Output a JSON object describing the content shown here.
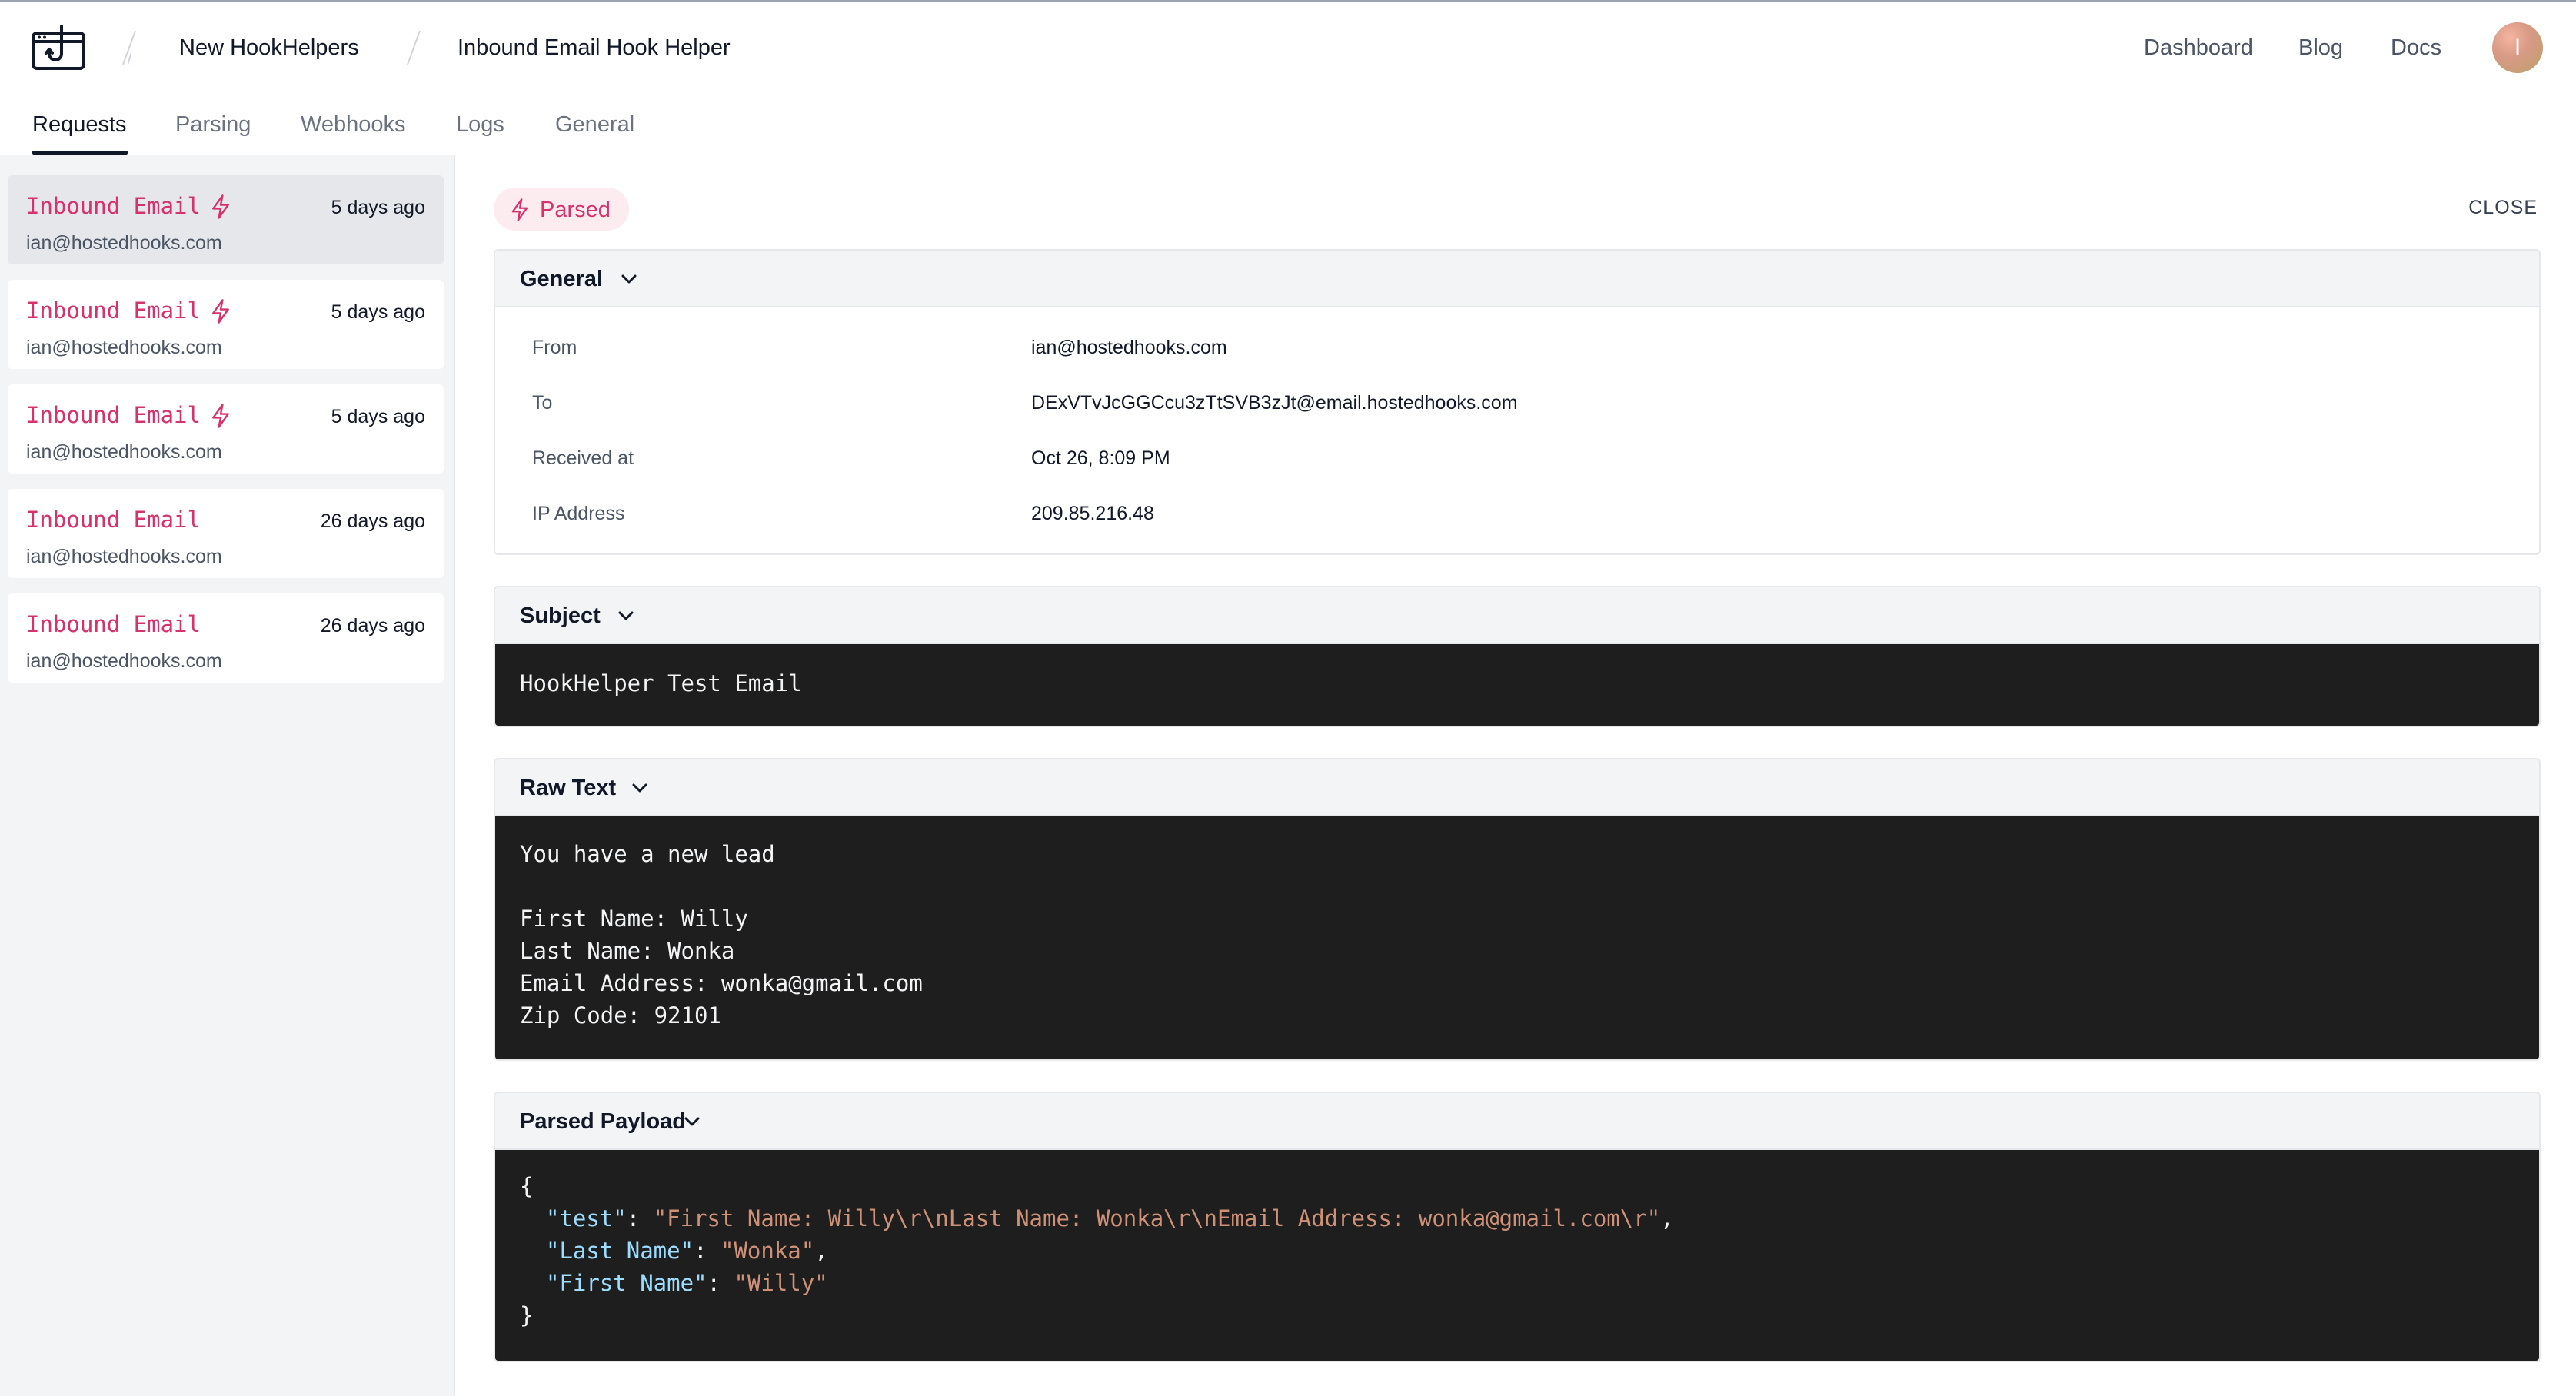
{
  "breadcrumb": {
    "project": "New HookHelpers",
    "helper": "Inbound Email Hook Helper"
  },
  "nav": {
    "dashboard": "Dashboard",
    "blog": "Blog",
    "docs": "Docs",
    "avatar_initial": "I"
  },
  "tabs": [
    "Requests",
    "Parsing",
    "Webhooks",
    "Logs",
    "General"
  ],
  "requests": [
    {
      "title": "Inbound Email",
      "time": "5 days ago",
      "email": "ian@hostedhooks.com",
      "parsed": true,
      "selected": true
    },
    {
      "title": "Inbound Email",
      "time": "5 days ago",
      "email": "ian@hostedhooks.com",
      "parsed": true,
      "selected": false
    },
    {
      "title": "Inbound Email",
      "time": "5 days ago",
      "email": "ian@hostedhooks.com",
      "parsed": true,
      "selected": false
    },
    {
      "title": "Inbound Email",
      "time": "26 days ago",
      "email": "ian@hostedhooks.com",
      "parsed": false,
      "selected": false
    },
    {
      "title": "Inbound Email",
      "time": "26 days ago",
      "email": "ian@hostedhooks.com",
      "parsed": false,
      "selected": false
    }
  ],
  "detail": {
    "status_badge": "Parsed",
    "close_label": "CLOSE",
    "general": {
      "title": "General",
      "rows": [
        {
          "label": "From",
          "value": "ian@hostedhooks.com"
        },
        {
          "label": "To",
          "value": "DExVTvJcGGCcu3zTtSVB3zJt@email.hostedhooks.com"
        },
        {
          "label": "Received at",
          "value": "Oct 26, 8:09 PM"
        },
        {
          "label": "IP Address",
          "value": "209.85.216.48"
        }
      ]
    },
    "subject": {
      "title": "Subject",
      "value": "HookHelper Test Email"
    },
    "raw_text": {
      "title": "Raw Text",
      "lines": [
        "You have a new lead",
        "",
        "First Name: Willy",
        "Last Name: Wonka",
        "Email Address: wonka@gmail.com",
        "Zip Code: 92101"
      ]
    },
    "parsed_payload": {
      "title": "Parsed Payload",
      "open_brace": "{",
      "close_brace": "}",
      "entries": [
        {
          "key": "\"test\"",
          "value": "\"First Name: Willy\\r\\nLast Name: Wonka\\r\\nEmail Address: wonka@gmail.com\\r\"",
          "sep": ","
        },
        {
          "key": "\"Last Name\"",
          "value": "\"Wonka\"",
          "sep": ","
        },
        {
          "key": "\"First Name\"",
          "value": "\"Willy\"",
          "sep": ""
        }
      ]
    }
  },
  "colors": {
    "accent": "#d6336c",
    "code_bg": "#1e1e1e",
    "json_key": "#9cdcfe",
    "json_string": "#ce9178"
  }
}
